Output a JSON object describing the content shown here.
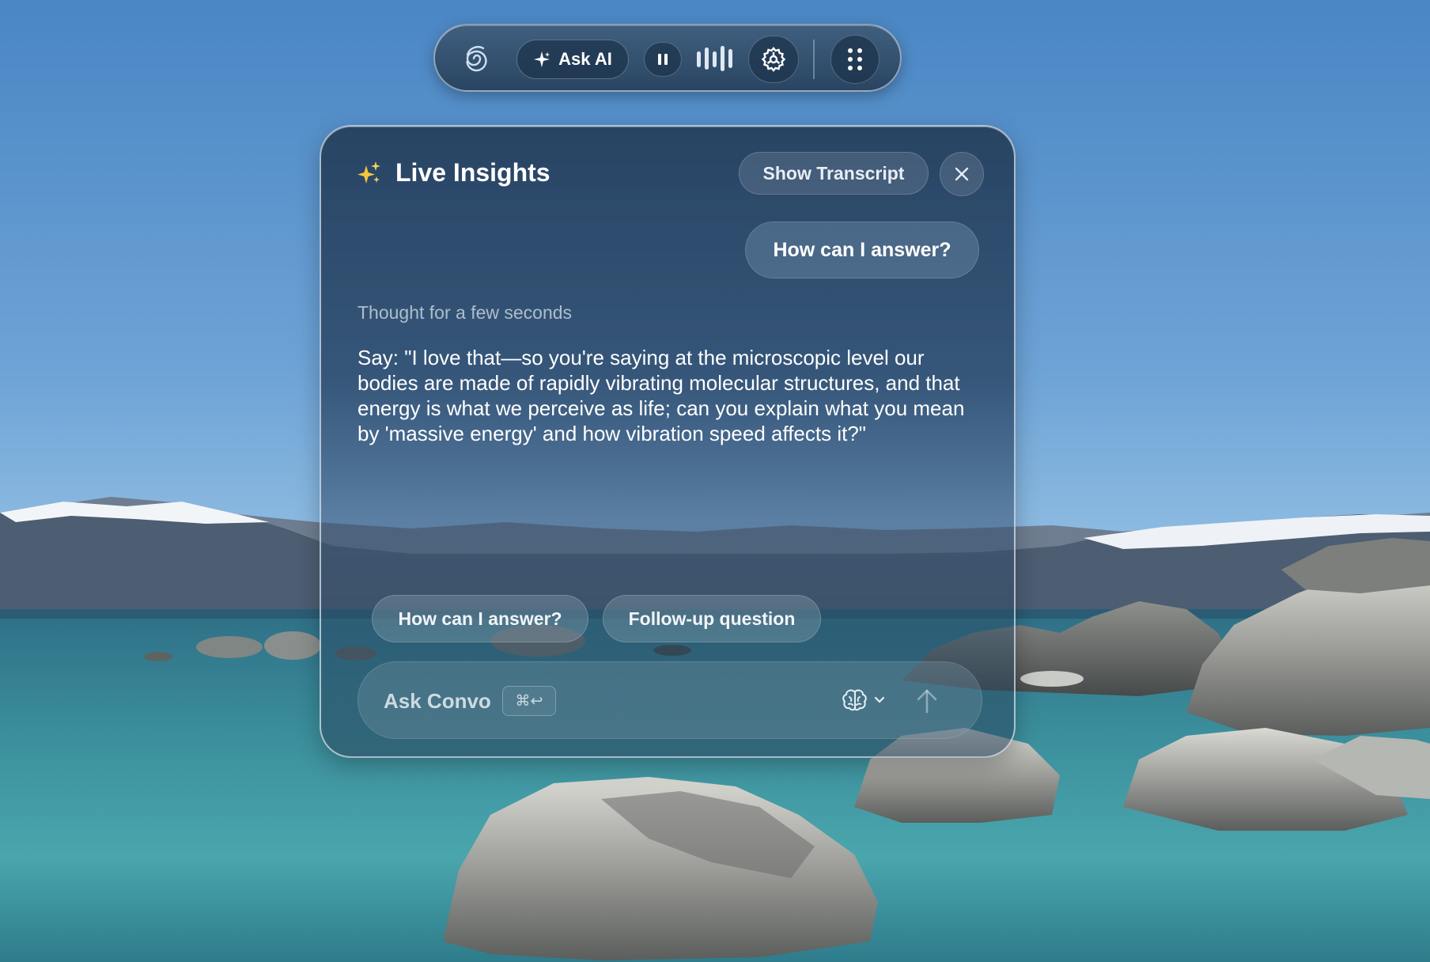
{
  "colors": {
    "accent_sparkle": "#f3c640",
    "panel_bg": "#2d4a6a",
    "text_primary": "#ffffff",
    "text_muted": "#c8d4e0"
  },
  "toolbar": {
    "ask_ai_label": "Ask AI",
    "icons": [
      "swirl-logo-icon",
      "sparkle-icon",
      "pause-icon",
      "audio-waveform-icon",
      "gear-icon",
      "grid-dots-icon"
    ]
  },
  "panel": {
    "title": "Live Insights",
    "show_transcript_label": "Show Transcript",
    "user_message": "How can I answer?",
    "thought_label": "Thought for a few seconds",
    "answer": "Say: \"I love that—so you're saying at the microscopic level our bodies are made of rapidly vibrating molecular structures, and that energy is what we perceive as life; can you explain what you mean by 'massive energy' and how vibration speed affects it?\"",
    "suggestions": [
      "How can I answer?",
      "Follow-up question"
    ],
    "input": {
      "placeholder": "Ask Convo",
      "shortcut": "⌘↩"
    }
  }
}
